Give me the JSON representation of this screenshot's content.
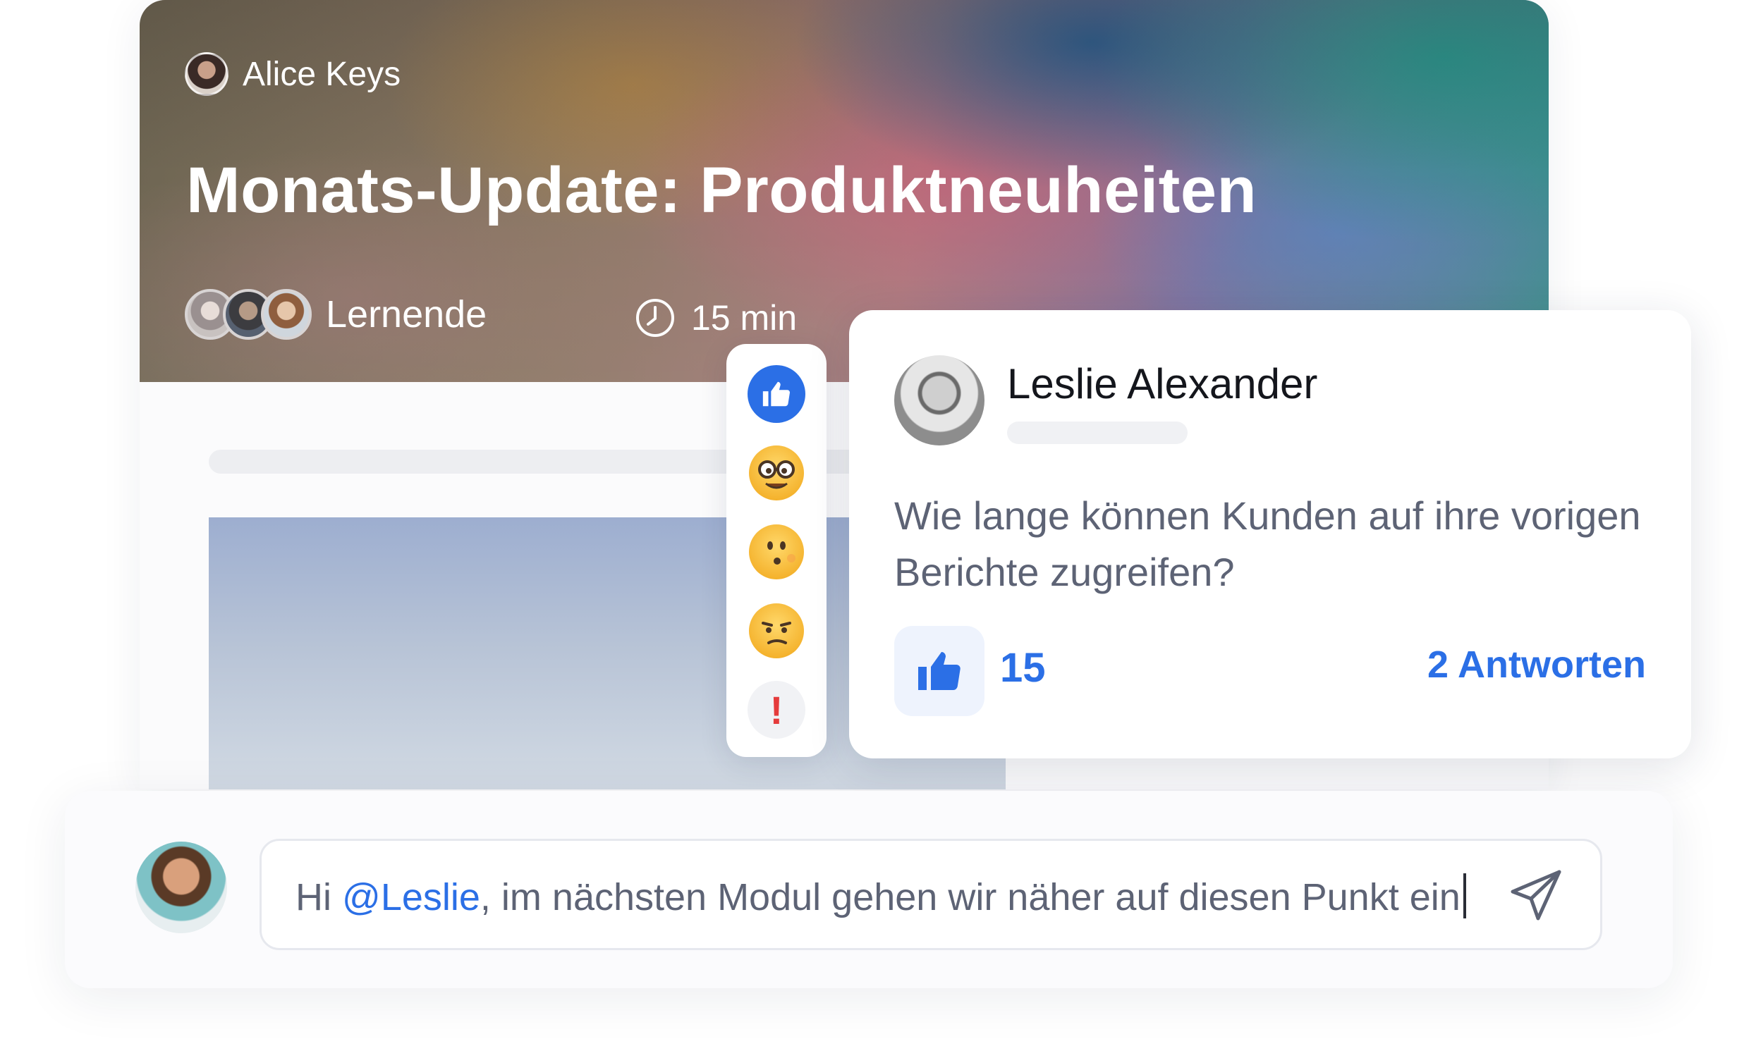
{
  "course": {
    "author_name": "Alice Keys",
    "title": "Monats-Update: Produktneuheiten",
    "learners_label": "Lernende",
    "duration_label": "15 min"
  },
  "reactions": [
    {
      "name": "thumbs-up",
      "color": "#2b6fe6"
    },
    {
      "name": "nerd-face"
    },
    {
      "name": "surprised-face"
    },
    {
      "name": "confused-face"
    },
    {
      "name": "exclamation",
      "symbol": "!",
      "color": "#e53b3b"
    }
  ],
  "comment": {
    "author": "Leslie Alexander",
    "text": "Wie lange können Kunden auf ihre vorigen Berichte zugreifen?",
    "like_count": "15",
    "replies_label": "2 Antworten"
  },
  "reply": {
    "prefix": "Hi ",
    "mention": "@Leslie",
    "rest": ", im nächsten Modul gehen wir näher auf diesen Punkt ein"
  },
  "colors": {
    "accent": "#2b6fe6",
    "alert": "#e53b3b",
    "text_muted": "#5d6375"
  }
}
